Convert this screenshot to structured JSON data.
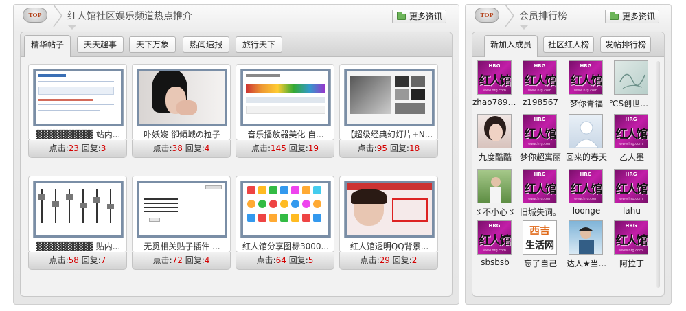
{
  "left_panel": {
    "badge": "TOP",
    "title": "红人馆社区娱乐频道热点推介",
    "more_label": "更多资讯",
    "tabs": [
      {
        "label": "精华帖子",
        "active": true
      },
      {
        "label": "天天趣事",
        "active": false
      },
      {
        "label": "天下万象",
        "active": false
      },
      {
        "label": "热闻速报",
        "active": false
      },
      {
        "label": "旅行天下",
        "active": false
      }
    ],
    "posts": [
      {
        "title": "▓▓▓▓▓▓▓▓▓ 站内...",
        "clicks_label": "点击:",
        "clicks": "23",
        "replies_label": "回复:",
        "replies": "3"
      },
      {
        "title": "卟妖娆 卻傾城の粒子",
        "clicks_label": "点击:",
        "clicks": "38",
        "replies_label": "回复:",
        "replies": "4"
      },
      {
        "title": "音乐播放器美化 自...",
        "clicks_label": "点击:",
        "clicks": "145",
        "replies_label": "回复:",
        "replies": "19"
      },
      {
        "title": "【超级经典幻灯片+N...",
        "clicks_label": "点击:",
        "clicks": "95",
        "replies_label": "回复:",
        "replies": "18"
      },
      {
        "title": "▓▓▓▓▓▓▓▓▓ 贴内...",
        "clicks_label": "点击:",
        "clicks": "58",
        "replies_label": "回复:",
        "replies": "7"
      },
      {
        "title": "无觅相关贴子插件 ...",
        "clicks_label": "点击:",
        "clicks": "72",
        "replies_label": "回复:",
        "replies": "4"
      },
      {
        "title": "红人馆分享图标3000...",
        "clicks_label": "点击:",
        "clicks": "64",
        "replies_label": "回复:",
        "replies": "5"
      },
      {
        "title": "红人馆透明QQ背景...",
        "clicks_label": "点击:",
        "clicks": "29",
        "replies_label": "回复:",
        "replies": "2"
      }
    ]
  },
  "right_panel": {
    "badge": "TOP",
    "title": "会员排行榜",
    "more_label": "更多资讯",
    "tabs": [
      {
        "label": "新加入成员",
        "active": true
      },
      {
        "label": "社区红人榜",
        "active": false
      },
      {
        "label": "发帖排行榜",
        "active": false
      }
    ],
    "members": [
      {
        "name": "zhao7891...",
        "avatar": "logo"
      },
      {
        "name": "z198567",
        "avatar": "logo"
      },
      {
        "name": "梦你青福",
        "avatar": "logo"
      },
      {
        "name": "℃S创世ァ...",
        "avatar": "sketch"
      },
      {
        "name": "九度酷酷",
        "avatar": "photo-girl"
      },
      {
        "name": "梦你超寓丽",
        "avatar": "logo"
      },
      {
        "name": "回来的春天",
        "avatar": "default-user"
      },
      {
        "name": "乙人墨",
        "avatar": "logo"
      },
      {
        "name": "ゞ不小心ゞ",
        "avatar": "photo-outdoor"
      },
      {
        "name": "旧城失词。",
        "avatar": "logo"
      },
      {
        "name": "loonge",
        "avatar": "logo"
      },
      {
        "name": "lahu",
        "avatar": "logo"
      },
      {
        "name": "sbsbsb",
        "avatar": "logo"
      },
      {
        "name": "忘了自己",
        "avatar": "xiji"
      },
      {
        "name": "达人★当...",
        "avatar": "photo-guy"
      },
      {
        "name": "阿拉丁",
        "avatar": "logo"
      }
    ],
    "logo_text": {
      "l1": "HRG",
      "l2": "红人馆",
      "l3": "www.hrg.com"
    },
    "xiji_text": {
      "top": "西吉",
      "bottom": "生活网"
    }
  }
}
